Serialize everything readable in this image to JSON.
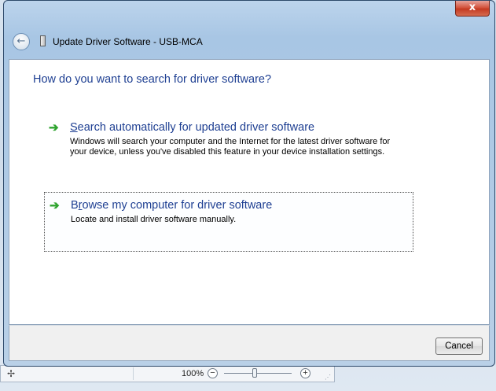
{
  "background": {
    "zoom_level": "100%",
    "zoom_minus": "−",
    "zoom_plus": "+",
    "move_glyph": "✢"
  },
  "dialog": {
    "title": "Update Driver Software - USB-MCA",
    "close_label": "x",
    "back_glyph": "←",
    "heading": "How do you want to search for driver software?",
    "options": [
      {
        "title_prefix": "",
        "title_underlined": "S",
        "title_rest": "earch automatically for updated driver software",
        "description": "Windows will search your computer and the Internet for the latest driver software for your device, unless you've disabled this feature in your device installation settings.",
        "icon": "green-arrow-icon"
      },
      {
        "title_prefix": "B",
        "title_underlined": "r",
        "title_rest": "owse my computer for driver software",
        "description": "Locate and install driver software manually.",
        "icon": "green-arrow-icon"
      }
    ],
    "cancel_label": "Cancel"
  },
  "colors": {
    "link_blue": "#1e3f92",
    "arrow_green": "#2fa42f",
    "close_red": "#c43a22"
  }
}
